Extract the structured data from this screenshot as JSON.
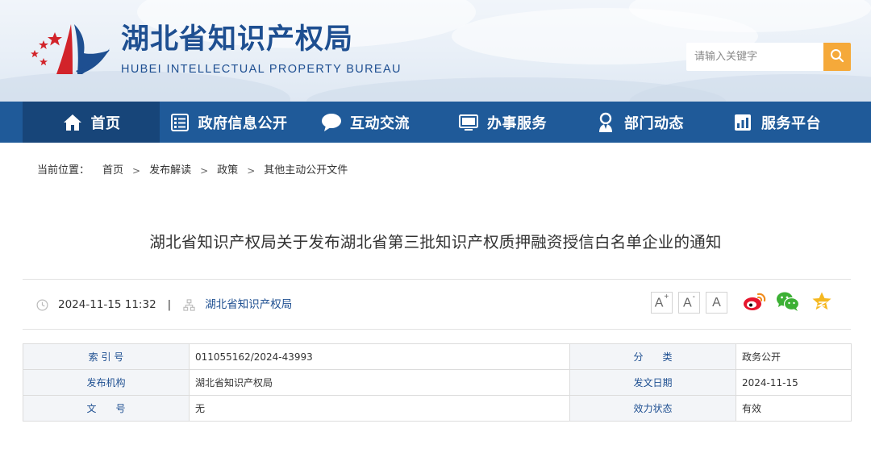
{
  "header": {
    "site_name_cn": "湖北省知识产权局",
    "site_name_en": "HUBEI INTELLECTUAL PROPERTY BUREAU",
    "search": {
      "placeholder": "请输入关键字"
    },
    "colors": {
      "brand_blue": "#1e4f91",
      "search_button": "#f5a93a",
      "logo_red": "#d2232a"
    }
  },
  "nav": {
    "items": [
      {
        "label": "首页",
        "icon": "home-icon",
        "active": true
      },
      {
        "label": "政府信息公开",
        "icon": "document-list-icon",
        "active": false
      },
      {
        "label": "互动交流",
        "icon": "chat-bubble-icon",
        "active": false
      },
      {
        "label": "办事服务",
        "icon": "monitor-icon",
        "active": false
      },
      {
        "label": "部门动态",
        "icon": "person-badge-icon",
        "active": false
      },
      {
        "label": "服务平台",
        "icon": "bar-chart-icon",
        "active": false
      }
    ],
    "colors": {
      "background": "#1f5a99",
      "active": "#174579"
    }
  },
  "breadcrumb": {
    "label": "当前位置：",
    "items": [
      "首页",
      "发布解读",
      "政策",
      "其他主动公开文件"
    ],
    "separator": ">"
  },
  "article": {
    "title": "湖北省知识产权局关于发布湖北省第三批知识产权质押融资授信白名单企业的通知",
    "datetime": "2024-11-15 11:32",
    "divider": "|",
    "source": "湖北省知识产权局"
  },
  "toolbar": {
    "font_buttons": [
      {
        "label": "A",
        "suffix": "+",
        "icon": "font-increase-icon"
      },
      {
        "label": "A",
        "suffix": "-",
        "icon": "font-decrease-icon"
      },
      {
        "label": "A",
        "suffix": "",
        "icon": "font-reset-icon"
      }
    ],
    "share": [
      {
        "icon": "weibo-icon",
        "color": "#e6162d"
      },
      {
        "icon": "wechat-icon",
        "color": "#3cb034"
      },
      {
        "icon": "favorite-star-icon",
        "color": "#f5b820"
      }
    ]
  },
  "info_table": {
    "rows": [
      {
        "k1": "索 引 号",
        "v1": "011055162/2024-43993",
        "k2": "分　　类",
        "v2": "政务公开"
      },
      {
        "k1": "发布机构",
        "v1": "湖北省知识产权局",
        "k2": "发文日期",
        "v2": "2024-11-15"
      },
      {
        "k1": "文　　号",
        "v1": "无",
        "k2": "效力状态",
        "v2": "有效"
      }
    ]
  }
}
